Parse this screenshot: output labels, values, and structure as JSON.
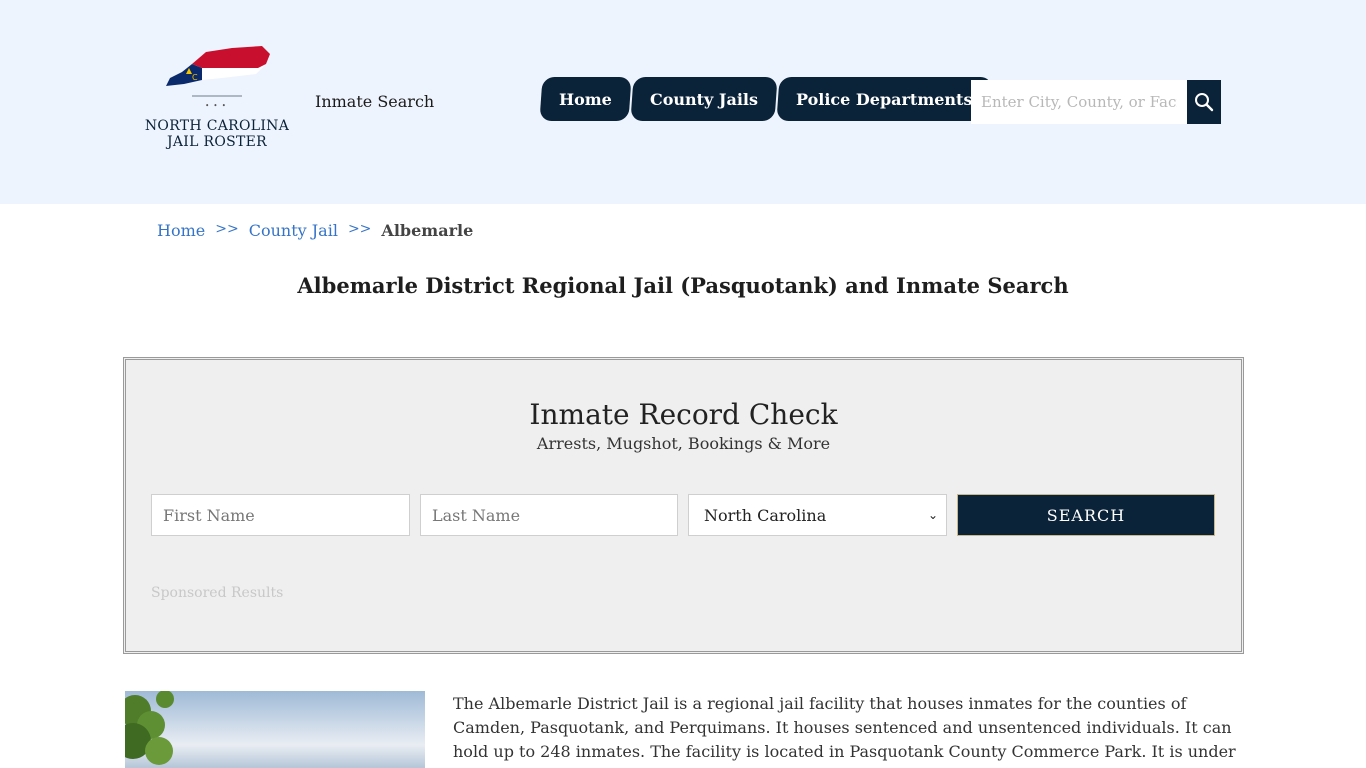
{
  "header": {
    "logo_text_line1": "NORTH CAROLINA",
    "logo_text_line2": "JAIL ROSTER",
    "logo_dots": "• • •",
    "inmate_search_label": "Inmate Search",
    "nav": [
      {
        "label": "Home"
      },
      {
        "label": "County Jails"
      },
      {
        "label": "Police Departments"
      }
    ],
    "search_placeholder": "Enter City, County, or Facility"
  },
  "breadcrumb": {
    "home": "Home",
    "sep": ">>",
    "county": "County Jail",
    "current": "Albemarle"
  },
  "page_title": "Albemarle District Regional Jail (Pasquotank) and Inmate Search",
  "record_check": {
    "title": "Inmate Record Check",
    "subtitle": "Arrests, Mugshot, Bookings & More",
    "first_placeholder": "First Name",
    "last_placeholder": "Last Name",
    "state_selected": "North Carolina",
    "search_label": "SEARCH",
    "sponsored": "Sponsored Results"
  },
  "content": {
    "paragraph": "The Albemarle District Jail is a regional jail facility that houses inmates for the counties of Camden, Pasquotank, and Perquimans. It houses sentenced and unsentenced individuals. It can hold up to 248 inmates. The facility is located in Pasquotank County Commerce Park. It is under the supervision of Jail"
  },
  "colors": {
    "header_bg": "#eef4fe",
    "navy": "#0b2339",
    "link_blue": "#3674c7",
    "box_bg": "#efefef"
  }
}
